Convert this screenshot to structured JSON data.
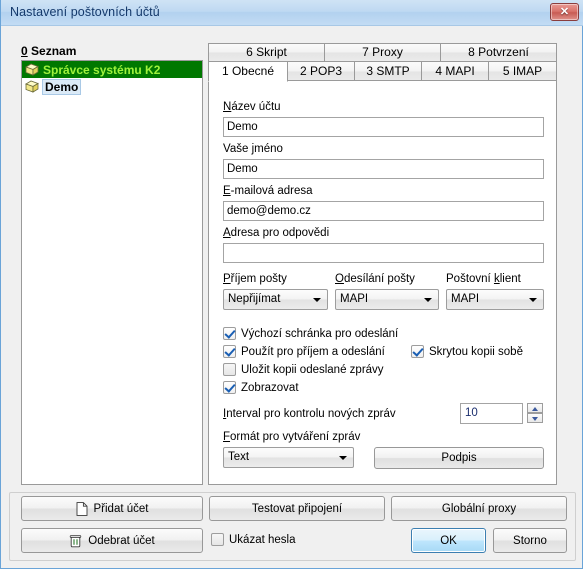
{
  "window": {
    "title": "Nastavení poštovních účtů",
    "close_label": "✕",
    "accent_titlebar": "#bfd9f2",
    "close_color": "#c85c54"
  },
  "list_panel": {
    "label_accel": "0",
    "label_rest": " Seznam",
    "selected_bg": "#007800",
    "selected_fg": "#9ef23c",
    "items": [
      {
        "label": "Správce systému K2",
        "selected": true
      },
      {
        "label": "Demo",
        "selected": false
      }
    ]
  },
  "tabs": {
    "top_row": [
      {
        "label": "6 Skript"
      },
      {
        "label": "7 Proxy"
      },
      {
        "label": "8 Potvrzení"
      }
    ],
    "bottom_row": [
      {
        "label": "1 Obecné",
        "active": true
      },
      {
        "label": "2 POP3",
        "active": false
      },
      {
        "label": "3 SMTP",
        "active": false
      },
      {
        "label": "4 MAPI",
        "active": false
      },
      {
        "label": "5 IMAP",
        "active": false
      }
    ]
  },
  "form": {
    "account_name": {
      "accel": "N",
      "rest": "ázev účtu",
      "value": "Demo",
      "placeholder": ""
    },
    "your_name": {
      "pre": "Vaše ",
      "accel": "j",
      "rest": "méno",
      "value": "Demo",
      "placeholder": ""
    },
    "email": {
      "accel": "E",
      "rest": "-mailová adresa",
      "value": "demo@demo.cz",
      "placeholder": ""
    },
    "reply_to": {
      "accel": "A",
      "rest": "dresa pro odpovědi",
      "value": "",
      "placeholder": ""
    },
    "receive_mail": {
      "accel": "P",
      "rest": "říjem pošty",
      "value": "Nepřijímat"
    },
    "send_mail": {
      "accel": "O",
      "rest": "desílání pošty",
      "value": "MAPI"
    },
    "mail_client": {
      "pre": "Poštovní ",
      "accel": "k",
      "rest": "lient",
      "value": "MAPI"
    },
    "checkboxes": [
      {
        "label": "Výchozí schránka pro odeslání",
        "checked": true
      },
      {
        "label": "Použít pro příjem a odeslání",
        "checked": true
      },
      {
        "label": "Uložit kopii odeslané zprávy",
        "checked": false
      },
      {
        "label": "Zobrazovat",
        "checked": true
      }
    ],
    "bcc_self": {
      "label": "Skrytou kopii sobě",
      "checked": true
    },
    "interval": {
      "accel": "I",
      "rest": "nterval pro kontrolu nových zpráv",
      "value": "10"
    },
    "format": {
      "accel": "F",
      "rest": "ormát pro vytváření zpráv",
      "value": "Text"
    },
    "signature_button": "Podpis"
  },
  "footer": {
    "add_account": {
      "label": "Přidat účet",
      "icon": "page-icon"
    },
    "remove_account": {
      "label": "Odebrat účet",
      "icon": "trash-icon"
    },
    "test_connection": "Testovat připojení",
    "global_proxy": "Globální proxy",
    "show_passwords": {
      "label": "Ukázat hesla",
      "checked": false
    },
    "ok": "OK",
    "cancel": "Storno"
  }
}
